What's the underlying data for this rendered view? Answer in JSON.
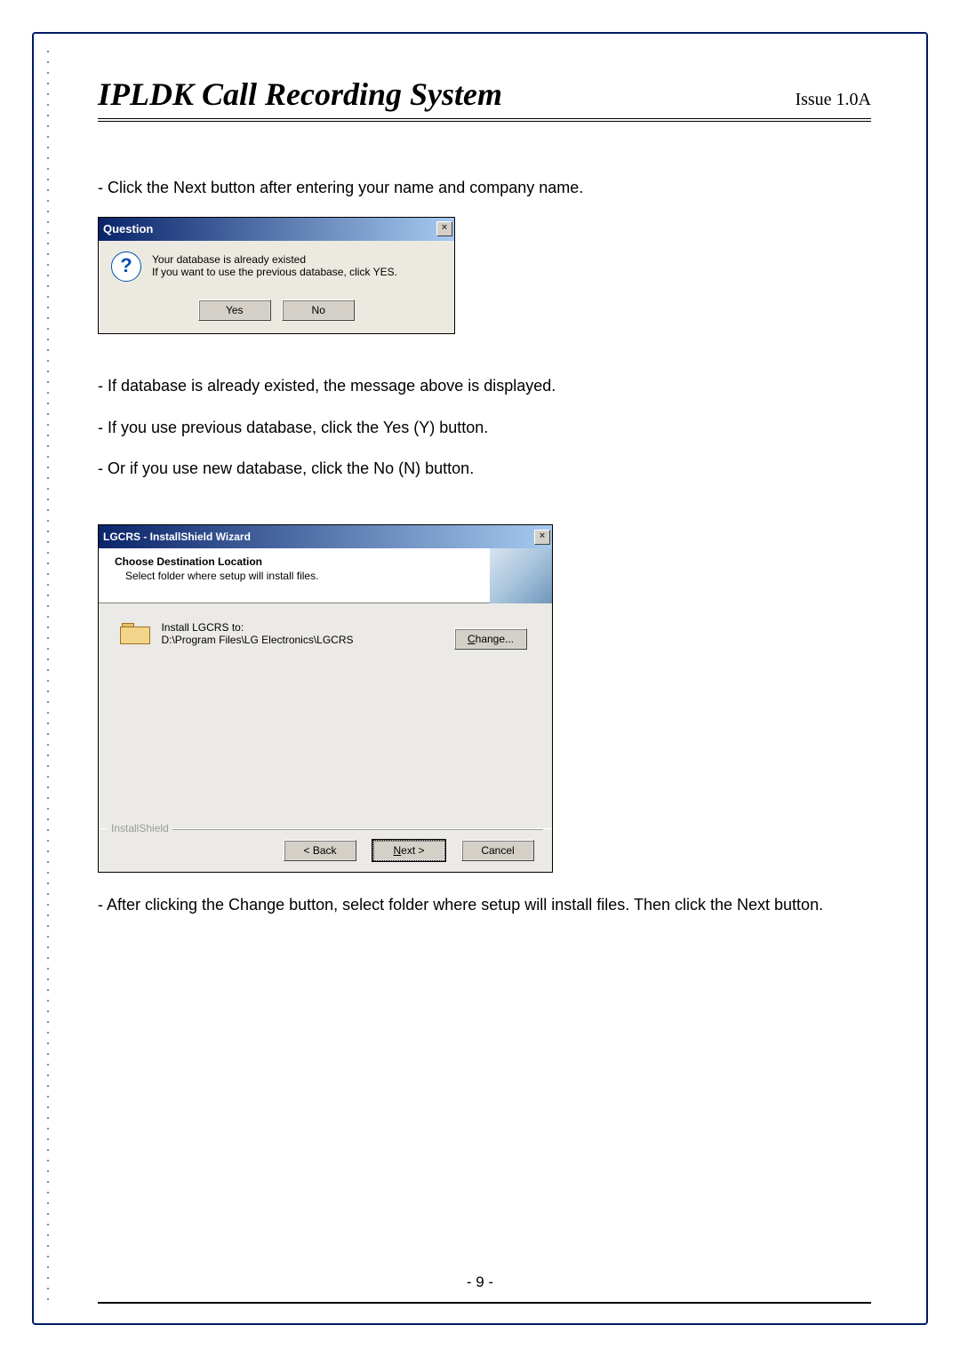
{
  "header": {
    "title": "IPLDK Call Recording System",
    "issue": "Issue 1.0A"
  },
  "text": {
    "line_intro": "- Click the Next button after entering your name and company name.",
    "line_existed": "- If database is already existed, the message above is displayed.",
    "line_prev": "- If you use previous database, click the Yes (Y) button.",
    "line_new": "- Or if you use new database, click the No (N) button.",
    "line_after_wizard": "- After clicking the Change button, select folder where setup will install files. Then click the Next button."
  },
  "dlg_question": {
    "title": "Question",
    "close": "×",
    "msg1": "Your database is already existed",
    "msg2": "If you want to use the previous database, click YES.",
    "yes": "Yes",
    "no": "No"
  },
  "dlg_wizard": {
    "title": "LGCRS - InstallShield Wizard",
    "close": "×",
    "head_title": "Choose Destination Location",
    "head_sub": "Select folder where setup will install files.",
    "install_label": "Install LGCRS to:",
    "install_path": "D:\\Program Files\\LG Electronics\\LGCRS",
    "change": "Change...",
    "brand": "InstallShield",
    "back": "< Back",
    "next": "Next >",
    "cancel": "Cancel"
  },
  "page_number": "- 9 -"
}
